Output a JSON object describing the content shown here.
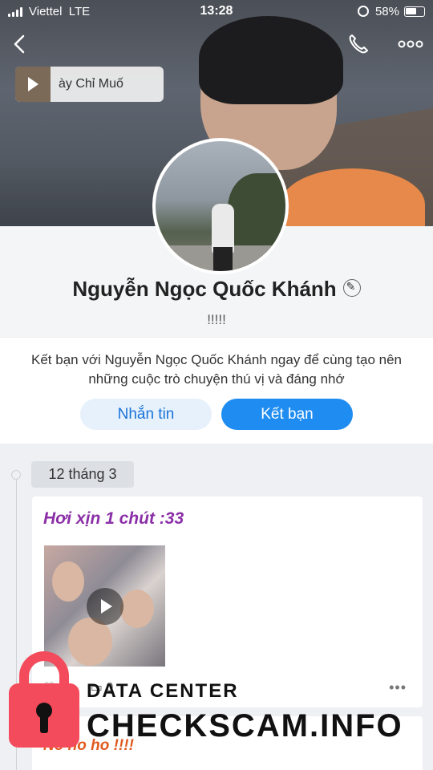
{
  "status_bar": {
    "carrier": "Viettel",
    "network": "LTE",
    "time": "13:28",
    "battery": "58%"
  },
  "header": {
    "back_icon": "chevron-left-icon",
    "call_icon": "phone-icon",
    "more_icon": "more-horizontal-icon",
    "music_chip_text": "ày         Chỉ Muố"
  },
  "profile": {
    "name": "Nguyễn Ngọc Quốc Khánh",
    "bio": "!!!!!",
    "edit_icon": "pencil-icon"
  },
  "friend_prompt": {
    "message": "Kết bạn với Nguyễn Ngọc Quốc Khánh ngay để cùng tạo nên những cuộc trò chuyện thú vị và đáng nhớ",
    "message_button": "Nhắn tin",
    "add_button": "Kết bạn"
  },
  "timeline": {
    "date": "12 tháng 3",
    "posts": [
      {
        "caption": "Hơi xịn 1 chút :33",
        "likes": "4",
        "comments": "0"
      },
      {
        "caption": "No ho ho !!!!"
      }
    ]
  },
  "watermark": {
    "line1": "DATA CENTER",
    "line2": "CHECKSCAM.INFO"
  },
  "colors": {
    "accent": "#1e8cf0",
    "caption_purple": "#8b2fa7",
    "caption_orange": "#e05a1f",
    "watermark_red": "#f34b5b"
  }
}
